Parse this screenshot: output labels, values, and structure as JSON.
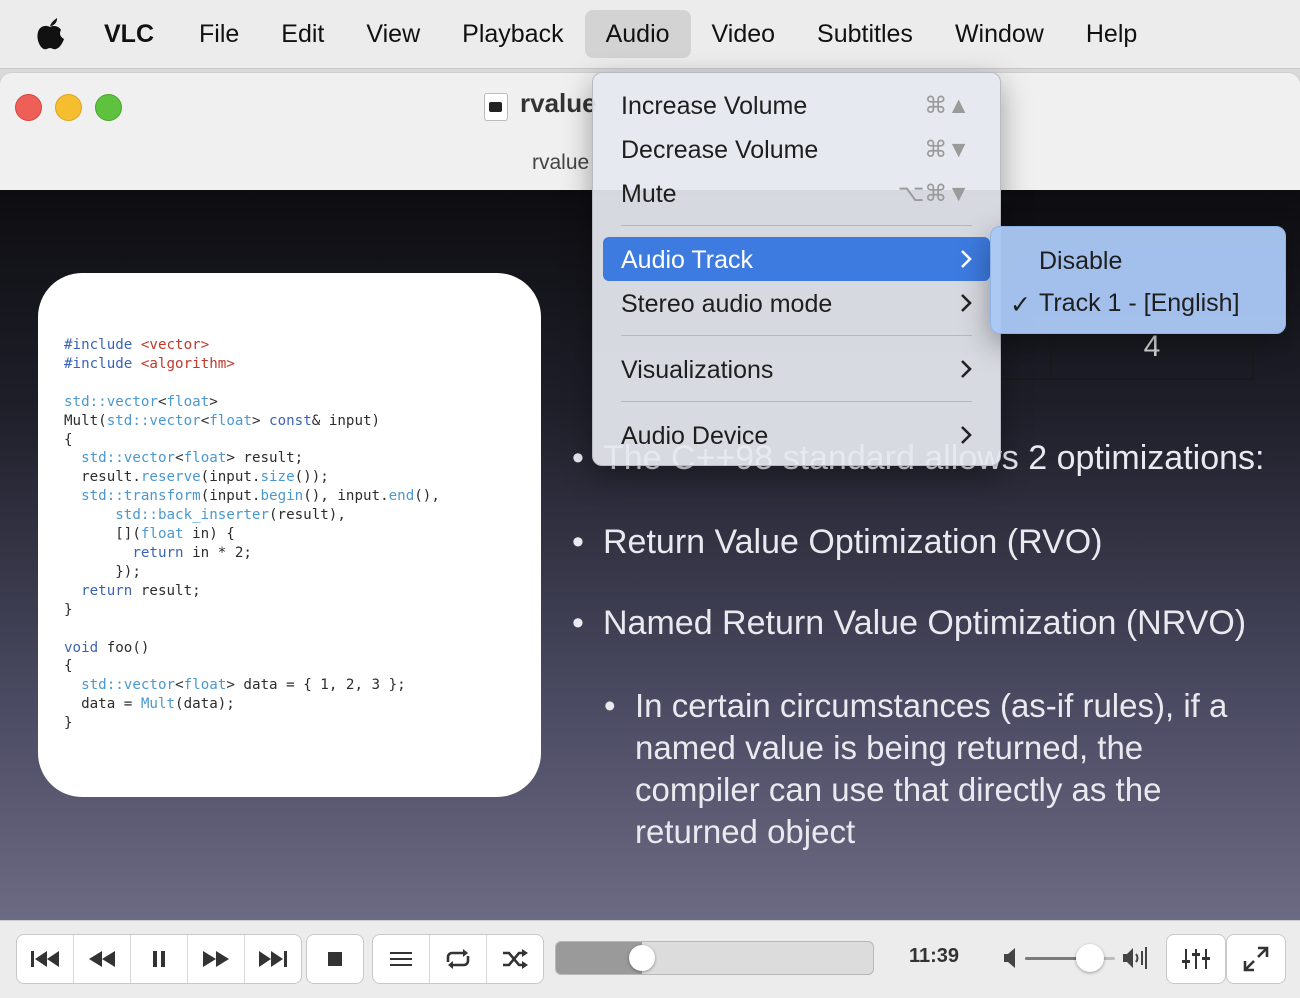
{
  "menubar": {
    "app": "VLC",
    "items": [
      "File",
      "Edit",
      "View",
      "Playback",
      "Audio",
      "Video",
      "Subtitles",
      "Window",
      "Help"
    ],
    "active": "Audio"
  },
  "window": {
    "title": "rvalue",
    "subtitle": "rvalue"
  },
  "slide": {
    "code_lines": [
      "#include <vector>",
      "#include <algorithm>",
      "",
      "std::vector<float>",
      "Mult(std::vector<float> const& input)",
      "{",
      "  std::vector<float> result;",
      "  result.reserve(input.size());",
      "  std::transform(input.begin(), input.end(),",
      "      std::back_inserter(result),",
      "      [](float in) {",
      "        return in * 2;",
      "      });",
      "  return result;",
      "}",
      "",
      "void foo()",
      "{",
      "  std::vector<float> data = { 1, 2, 3 };",
      "  data = Mult(data);",
      "}"
    ],
    "table_cell": "4",
    "bullet_partial": "The C++98 standard allows 2 optimizations:",
    "bullets": [
      "Return Value Optimization (RVO)",
      "Named Return Value Optimization (NRVO)"
    ],
    "sub_bullet_lines": [
      "In certain circumstances (as-if rules), if a",
      "named value is being returned, the",
      "compiler can use that directly as the",
      "returned object"
    ]
  },
  "audio_menu": {
    "items": [
      {
        "label": "Increase Volume",
        "shortcut": "⌘▲"
      },
      {
        "label": "Decrease Volume",
        "shortcut": "⌘▼"
      },
      {
        "label": "Mute",
        "shortcut": "⌥⌘▼"
      },
      {
        "label": "Audio Track"
      },
      {
        "label": "Stereo audio mode"
      },
      {
        "label": "Visualizations"
      },
      {
        "label": "Audio Device"
      }
    ],
    "highlighted": "Audio Track"
  },
  "audio_track_submenu": {
    "items": [
      "Disable",
      "Track 1 - [English]"
    ],
    "selected": "Track 1 - [English]",
    "check_glyph": "✓"
  },
  "controls": {
    "time": "11:39",
    "seek_progress": 0.27,
    "volume_level": 0.72
  },
  "icons": {
    "apple": "apple-logo-icon",
    "skip_back": "skip-previous-icon",
    "rewind": "rewind-icon",
    "pause": "pause-icon",
    "fast_forward": "fast-forward-icon",
    "skip_forward": "skip-next-icon",
    "stop": "stop-icon",
    "playlist": "playlist-icon",
    "loop": "loop-icon",
    "shuffle": "shuffle-icon",
    "volume_low": "volume-low-icon",
    "volume_high": "volume-high-icon",
    "equalizer": "equalizer-icon",
    "fullscreen": "fullscreen-icon",
    "submenu": "chevron-right-icon"
  },
  "colors": {
    "menu_highlight": "#3d7be0",
    "submenu_background": "#aac8f5",
    "close": "#ee5f57",
    "minimize": "#f6be2e",
    "zoom": "#5fc23f"
  }
}
